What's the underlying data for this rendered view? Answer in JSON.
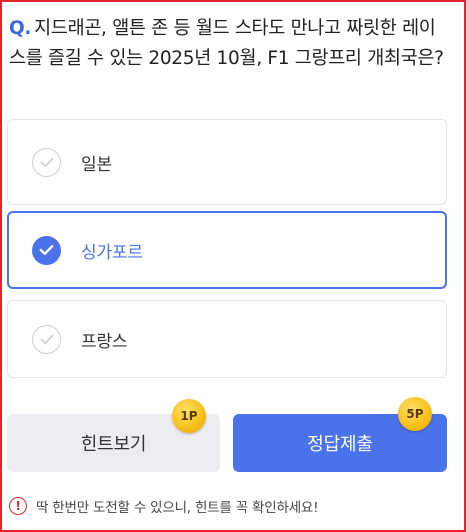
{
  "question": {
    "prefix": "Q.",
    "text": "지드래곤, 앨튼 존 등 월드 스타도 만나고 짜릿한 레이스를 즐길 수 있는 2025년 10월, F1 그랑프리 개최국은?"
  },
  "options": [
    {
      "label": "일본",
      "selected": false
    },
    {
      "label": "싱가포르",
      "selected": true
    },
    {
      "label": "프랑스",
      "selected": false
    }
  ],
  "buttons": {
    "hint_label": "힌트보기",
    "hint_cost": "1P",
    "submit_label": "정답제출",
    "submit_reward": "5P"
  },
  "notice": {
    "icon": "exclamation-circle-icon",
    "mark": "!",
    "text": "딱 한번만 도전할 수 있으니, 힌트를 꼭 확인하세요!"
  },
  "colors": {
    "accent": "#4a72ea",
    "frame": "#e2262b",
    "coin": "#f7c21a",
    "hint_bg": "#ececf1"
  }
}
